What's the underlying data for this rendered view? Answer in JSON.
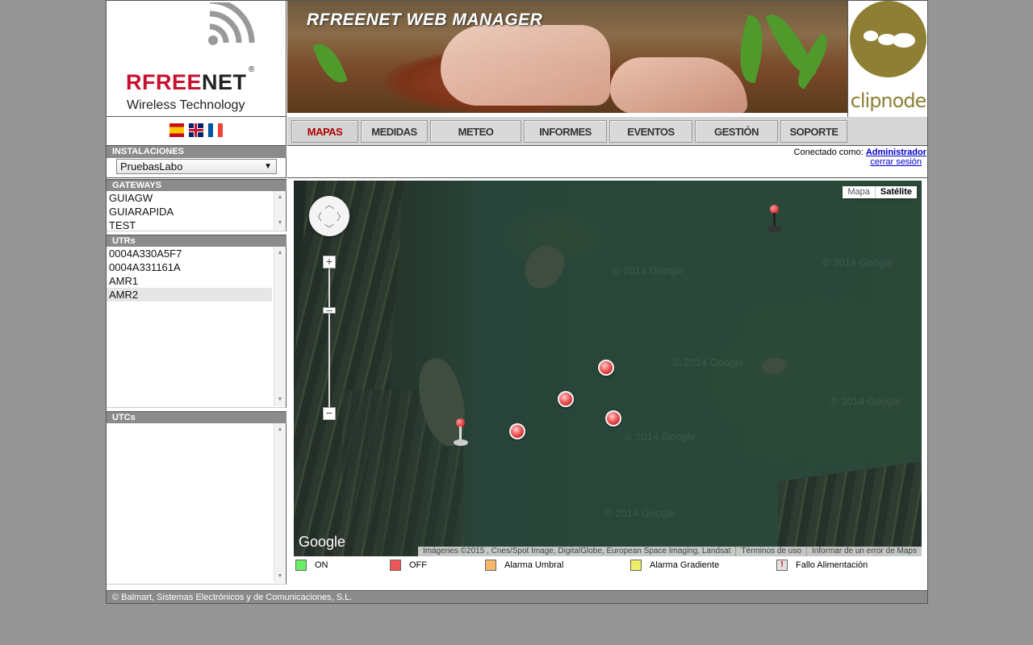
{
  "logo": {
    "brand_red": "RFREE",
    "brand_dark": "NET",
    "registered": "®",
    "tagline": "Wireless Technology"
  },
  "banner": {
    "title": "RFREENET WEB MANAGER"
  },
  "partner": {
    "name": "clipnode"
  },
  "languages": [
    {
      "code": "es",
      "icon": "flag-spain-icon"
    },
    {
      "code": "en",
      "icon": "flag-uk-icon"
    },
    {
      "code": "fr",
      "icon": "flag-france-icon"
    }
  ],
  "nav": {
    "active": "MAPAS",
    "items": [
      "MAPAS",
      "MEDIDAS",
      "METEO",
      "INFORMES",
      "EVENTOS",
      "GESTIÓN",
      "SOPORTE"
    ]
  },
  "installations": {
    "title": "INSTALACIONES",
    "selected": "PruebasLabo"
  },
  "gateways": {
    "title": "GATEWAYS",
    "items": [
      "GUIAGW",
      "GUIARAPIDA",
      "TEST"
    ]
  },
  "utrs": {
    "title": "UTRs",
    "items": [
      "0004A330A5F7",
      "0004A331161A",
      "AMR1",
      "AMR2"
    ],
    "selected": "AMR2"
  },
  "utcs": {
    "title": "UTCs",
    "items": []
  },
  "session": {
    "connected_label": "Conectado como:",
    "user": "Administrador",
    "logout": "cerrar sesión"
  },
  "map": {
    "type_options": {
      "map": "Mapa",
      "satellite": "Satélite"
    },
    "selected_type": "Satélite",
    "provider": "Google",
    "watermark": "© 2014 Google",
    "attribution": "Imágenes ©2015 , Cnes/Spot Image, DigitalGlobe, European Space Imaging, Landsat",
    "terms": "Términos de uso",
    "report": "Informar de un error de Maps",
    "marker_color": "#e85a5a"
  },
  "legend": [
    {
      "label": "ON",
      "color": "#66ee66"
    },
    {
      "label": "OFF",
      "color": "#ee5555"
    },
    {
      "label": "Alarma Umbral",
      "color": "#f6b86a"
    },
    {
      "label": "Alarma Gradiente",
      "color": "#eeee66"
    },
    {
      "label": "Fallo Alimentación",
      "color": "#e0e0e0",
      "icon": "exclamation-icon"
    }
  ],
  "footer": {
    "text": "© Balmart, Sistemas Electrónicos y de Comunicaciones, S.L."
  }
}
